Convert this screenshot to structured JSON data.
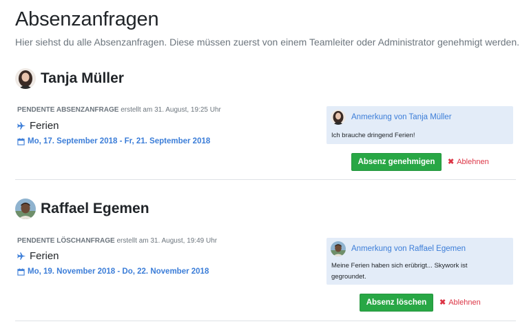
{
  "page": {
    "title": "Absenzanfragen",
    "subtitle": "Hier siehst du alle Absenzanfragen. Diese müssen zuerst von einem Teamleiter oder Administrator genehmigt werden."
  },
  "requests": [
    {
      "name": "Tanja Müller",
      "kind": "Pendente Absenzanfrage",
      "created": "erstellt am 31. August, 19:25 Uhr",
      "type": "Ferien",
      "date_range": "Mo, 17. September 2018 - Fr, 21. September 2018",
      "note_title": "Anmerkung von Tanja Müller",
      "note_text": "Ich brauche dringend Ferien!",
      "approve_label": "Absenz genehmigen",
      "reject_label": "Ablehnen"
    },
    {
      "name": "Raffael Egemen",
      "kind": "Pendente Löschanfrage",
      "created": "erstellt am 31. August, 19:49 Uhr",
      "type": "Ferien",
      "date_range": "Mo, 19. November 2018 - Do, 22. November 2018",
      "note_title": "Anmerkung von Raffael Egemen",
      "note_text": "Meine Ferien haben sich erübrigt... Skywork ist gegroundet.",
      "approve_label": "Absenz löschen",
      "reject_label": "Ablehnen"
    }
  ],
  "colors": {
    "accent": "#3b7dd8",
    "success": "#28a745",
    "danger": "#dc3545",
    "note_bg": "#e3ecf8"
  },
  "icons": {
    "type": "plane-icon",
    "date": "calendar-icon",
    "reject": "close-icon"
  }
}
